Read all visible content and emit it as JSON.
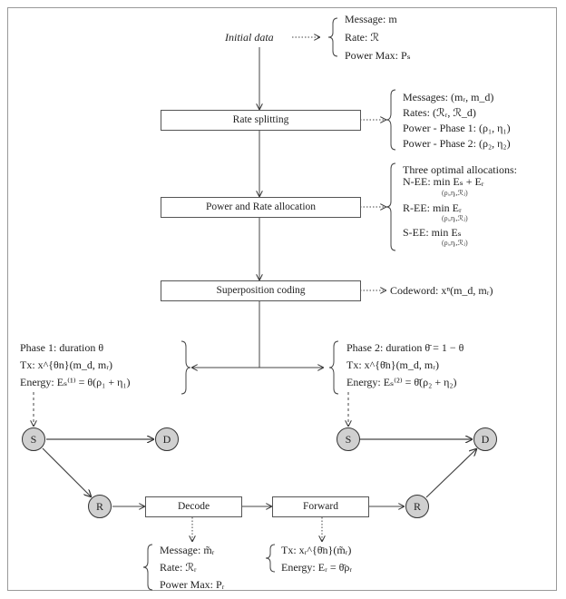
{
  "initial_data": {
    "label": "Initial data",
    "lines": [
      "Message: m",
      "Rate: ℛ",
      "Power Max: Pₛ"
    ]
  },
  "rate_splitting": {
    "label": "Rate splitting",
    "lines": [
      "Messages: (mᵣ, m_d)",
      "Rates: (ℛᵣ, ℛ_d)",
      "Power - Phase 1: (ρ₁, η₁)",
      "Power - Phase 2: (ρ₂, η₂)"
    ]
  },
  "power_rate_allocation": {
    "label": "Power and Rate allocation",
    "title": "Three optimal allocations:",
    "lines": [
      "N-EE:  min  Eₛ + Eᵣ",
      "R-EE:  min  Eᵣ",
      "S-EE:  min  Eₛ"
    ],
    "subscript": "(ρᵢ,ηᵢ,ℛⱼ)"
  },
  "superposition_coding": {
    "label": "Superposition coding",
    "codeword": "Codeword: xⁿ(m_d, mᵣ)"
  },
  "phase1": {
    "lines": [
      "Phase 1: duration θ",
      "Tx: x^{θn}(m_d, mᵣ)",
      "Energy: Eₛ⁽¹⁾ = θ(ρ₁ + η₁)"
    ]
  },
  "phase2": {
    "lines": [
      "Phase 2: duration θ̄ = 1 − θ",
      "Tx: x^{θ̄n}(m_d, mᵣ)",
      "Energy: Eₛ⁽²⁾ = θ̄(ρ₂ + η₂)"
    ]
  },
  "nodes": {
    "source": "S",
    "destination": "D",
    "relay": "R"
  },
  "decode": {
    "label": "Decode",
    "lines": [
      "Message: m̃ᵣ",
      "Rate: ℛᵣ",
      "Power Max: Pᵣ"
    ]
  },
  "forward": {
    "label": "Forward",
    "lines": [
      "Tx: xᵣ^{θ̄n}(m̃ᵣ)",
      "Energy: Eᵣ = θ̄ρᵣ"
    ]
  }
}
